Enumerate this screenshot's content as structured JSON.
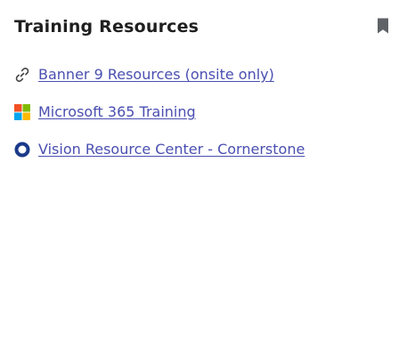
{
  "card": {
    "title": "Training Resources",
    "bookmark_icon": "bookmark-icon"
  },
  "resources": [
    {
      "label": "Banner 9 Resources (onsite only)",
      "icon": "link-icon"
    },
    {
      "label": "Microsoft 365 Training",
      "icon": "microsoft-logo-icon"
    },
    {
      "label": "Vision Resource Center - Cornerstone",
      "icon": "cornerstone-ring-icon"
    }
  ],
  "colors": {
    "link": "#4a4fb0",
    "title": "#1f1f1f",
    "bookmark": "#5f6368",
    "cornerstone_ring": "#1b3a8a",
    "ms_red": "#f25022",
    "ms_green": "#7fba00",
    "ms_blue": "#00a4ef",
    "ms_yellow": "#ffb900"
  }
}
